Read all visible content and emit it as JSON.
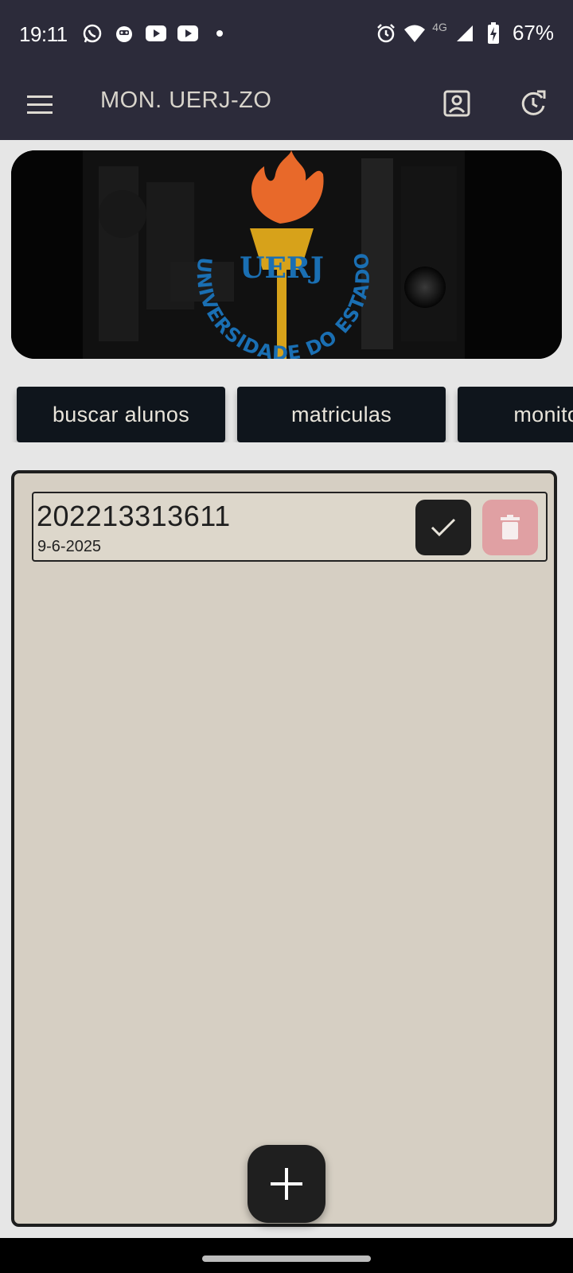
{
  "status_bar": {
    "time": "19:11",
    "left_icons": [
      "whatsapp-icon",
      "cat-app-icon",
      "youtube-icon",
      "youtube-icon",
      "dot-icon"
    ],
    "right_icons": [
      "alarm-icon",
      "wifi-icon",
      "signal-icon",
      "battery-charging-icon"
    ],
    "network_label": "4G",
    "battery": "67%"
  },
  "app_bar": {
    "title": "MON. UERJ-ZO",
    "icons": [
      "menu-icon",
      "profile-icon",
      "refresh-icon"
    ]
  },
  "banner": {
    "logo_text": "UERJ",
    "logo_ring_text": "UNIVERSIDADE DO ESTADO DO RIO DE JANEIRO"
  },
  "chips": [
    {
      "label": "buscar alunos"
    },
    {
      "label": "matriculas"
    },
    {
      "label": "monitores"
    }
  ],
  "list": {
    "items": [
      {
        "number": "202213313611",
        "date": "9-6-2025"
      }
    ]
  },
  "fab": {
    "icon": "plus-icon"
  },
  "colors": {
    "bar": "#2c2b3a",
    "chip": "#0f151c",
    "panel": "#d6cfc3",
    "delete": "#e0a0a3",
    "accent_blue": "#1a6fb3",
    "flame": "#e8692a"
  }
}
